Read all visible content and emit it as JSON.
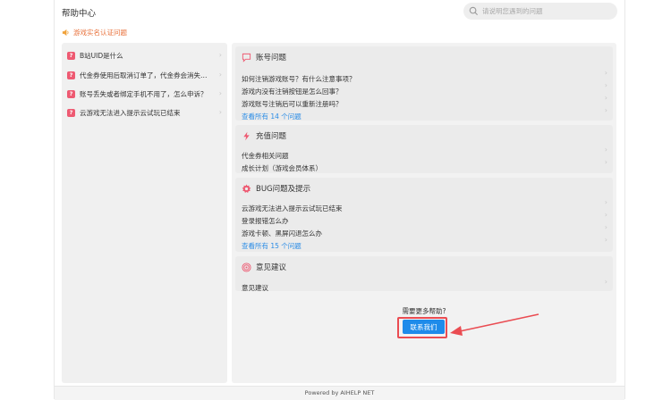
{
  "header": {
    "title": "帮助中心",
    "search_placeholder": "请说明您遇到的问题"
  },
  "notice": {
    "text": "游戏实名认证问题",
    "icon": "speaker-icon",
    "color": "#e8703a"
  },
  "left_items": [
    {
      "label": "B站UID是什么"
    },
    {
      "label": "代金券使用后取消订单了，代金券会消失吗？"
    },
    {
      "label": "账号丢失或者绑定手机不用了，怎么申诉？"
    },
    {
      "label": "云游戏无法进入提示云试玩已结束"
    }
  ],
  "sections": [
    {
      "icon": "chat-bubble-icon",
      "title": "账号问题",
      "rows": [
        "如何注销游戏账号？有什么注意事项？",
        "游戏内没有注销按钮是怎么回事？",
        "游戏账号注销后可以重新注册吗？"
      ],
      "link": "查看所有 14 个问题"
    },
    {
      "icon": "lightning-icon",
      "title": "充值问题",
      "rows": [
        "代金券相关问题",
        "成长计划（游戏会员体系）"
      ]
    },
    {
      "icon": "gear-icon",
      "title": "BUG问题及提示",
      "rows": [
        "云游戏无法进入提示云试玩已结束",
        "登录报错怎么办",
        "游戏卡顿、黑屏闪退怎么办"
      ],
      "link": "查看所有 15 个问题"
    },
    {
      "icon": "target-icon",
      "title": "意见建议",
      "rows": [
        "意见建议"
      ]
    }
  ],
  "help": {
    "text": "需要更多帮助?",
    "button": "联系我们"
  },
  "footer": {
    "text": "Powered by AIHELP NET"
  },
  "colors": {
    "accent": "#1e8bea",
    "badge": "#ee5a72",
    "annotation": "#ea4c52"
  }
}
